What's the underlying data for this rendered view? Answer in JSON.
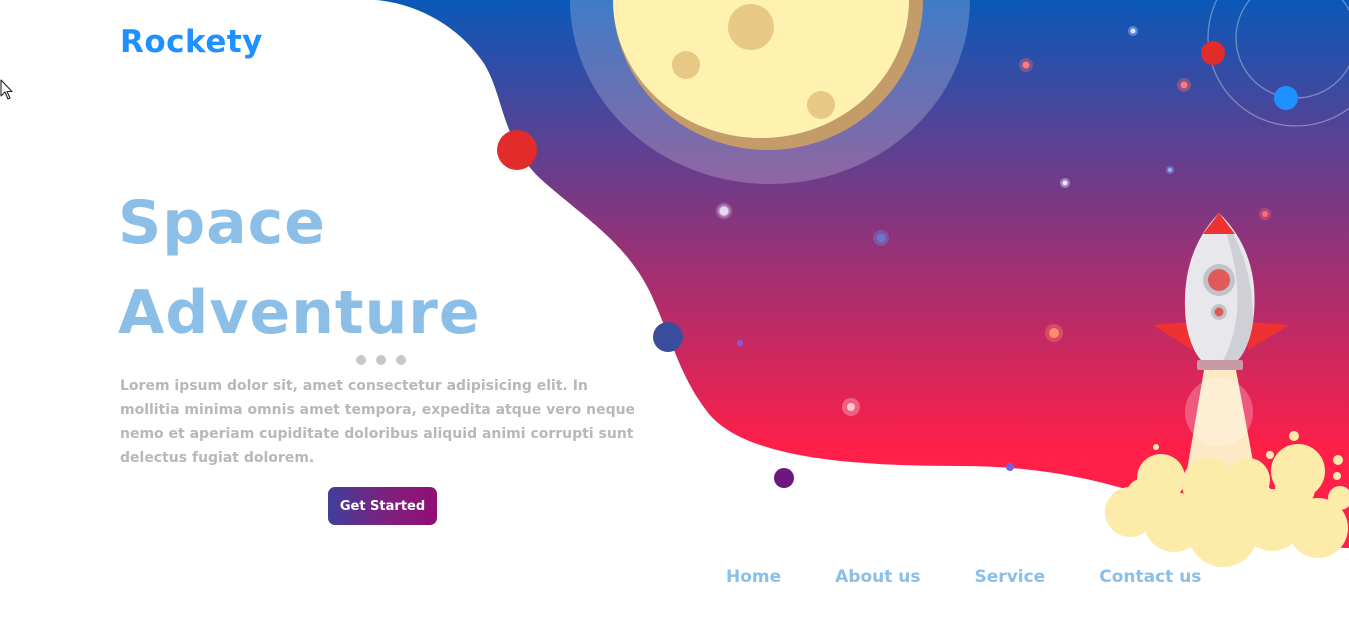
{
  "site": {
    "logo": "Rockety"
  },
  "hero": {
    "title_line1": "Space",
    "title_line2": "Adventure",
    "description": "Lorem ipsum dolor sit, amet consectetur adipisicing elit. In mollitia minima omnis amet tempora, expedita atque vero neque nemo et aperiam cupiditate doloribus aliquid animi corrupti sunt delectus fugiat dolorem.",
    "cta_label": "Get Started"
  },
  "nav": {
    "items": [
      {
        "label": "Home"
      },
      {
        "label": "About us"
      },
      {
        "label": "Service"
      },
      {
        "label": "Contact us"
      }
    ]
  },
  "theme": {
    "logo_color": "#1e90ff",
    "title_color": "#8bbfe8",
    "nav_color": "#8bbfe8",
    "space_top": "#0a58b8",
    "space_mid": "#8b347c",
    "space_bottom": "#ff1f48",
    "button_start": "#3f3f9a",
    "button_mid": "#7e207d",
    "button_end": "#920e73"
  },
  "icons": {
    "cursor": "mouse-pointer-icon",
    "moon": "moon-illustration",
    "rocket": "rocket-illustration",
    "orbit": "orbit-icon"
  }
}
